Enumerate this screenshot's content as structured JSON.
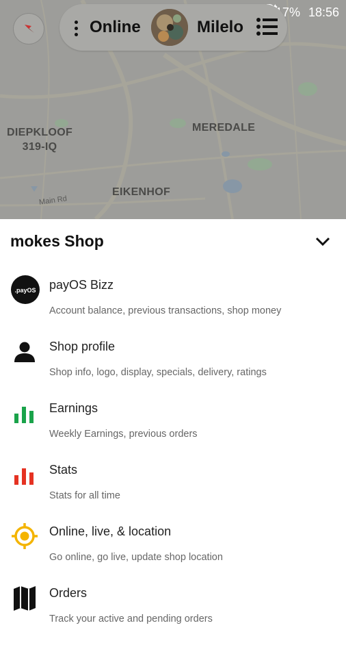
{
  "status_bar": {
    "battery": "17%",
    "time": "18:56"
  },
  "top_bar": {
    "status_label": "Online",
    "user_name": "Milelo"
  },
  "map": {
    "labels": [
      "DIEPKLOOF\n319-IQ",
      "MEREDALE",
      "EIKENHOF"
    ],
    "road_label": "Main Rd"
  },
  "sheet": {
    "title": "mokes Shop",
    "items": [
      {
        "label": "payOS Bizz",
        "sub": "Account balance, previous transactions, shop money",
        "icon": "payos-logo-icon"
      },
      {
        "label": "Shop profile",
        "sub": "Shop info, logo, display, specials, delivery, ratings",
        "icon": "person-icon"
      },
      {
        "label": "Earnings",
        "sub": "Weekly Earnings, previous orders",
        "icon": "bar-chart-icon"
      },
      {
        "label": "Stats",
        "sub": "Stats for all time",
        "icon": "bar-chart-icon"
      },
      {
        "label": "Online, live, & location",
        "sub": "Go online, go live, update shop location",
        "icon": "location-target-icon"
      },
      {
        "label": "Orders",
        "sub": "Track your active and pending orders",
        "icon": "map-icon"
      }
    ],
    "payos_logo_text": ".payOS"
  },
  "colors": {
    "earnings_green": "#1aa34a",
    "stats_red": "#e53222",
    "location_yellow": "#f4b400",
    "map_overlay": "#9d9d9a"
  }
}
